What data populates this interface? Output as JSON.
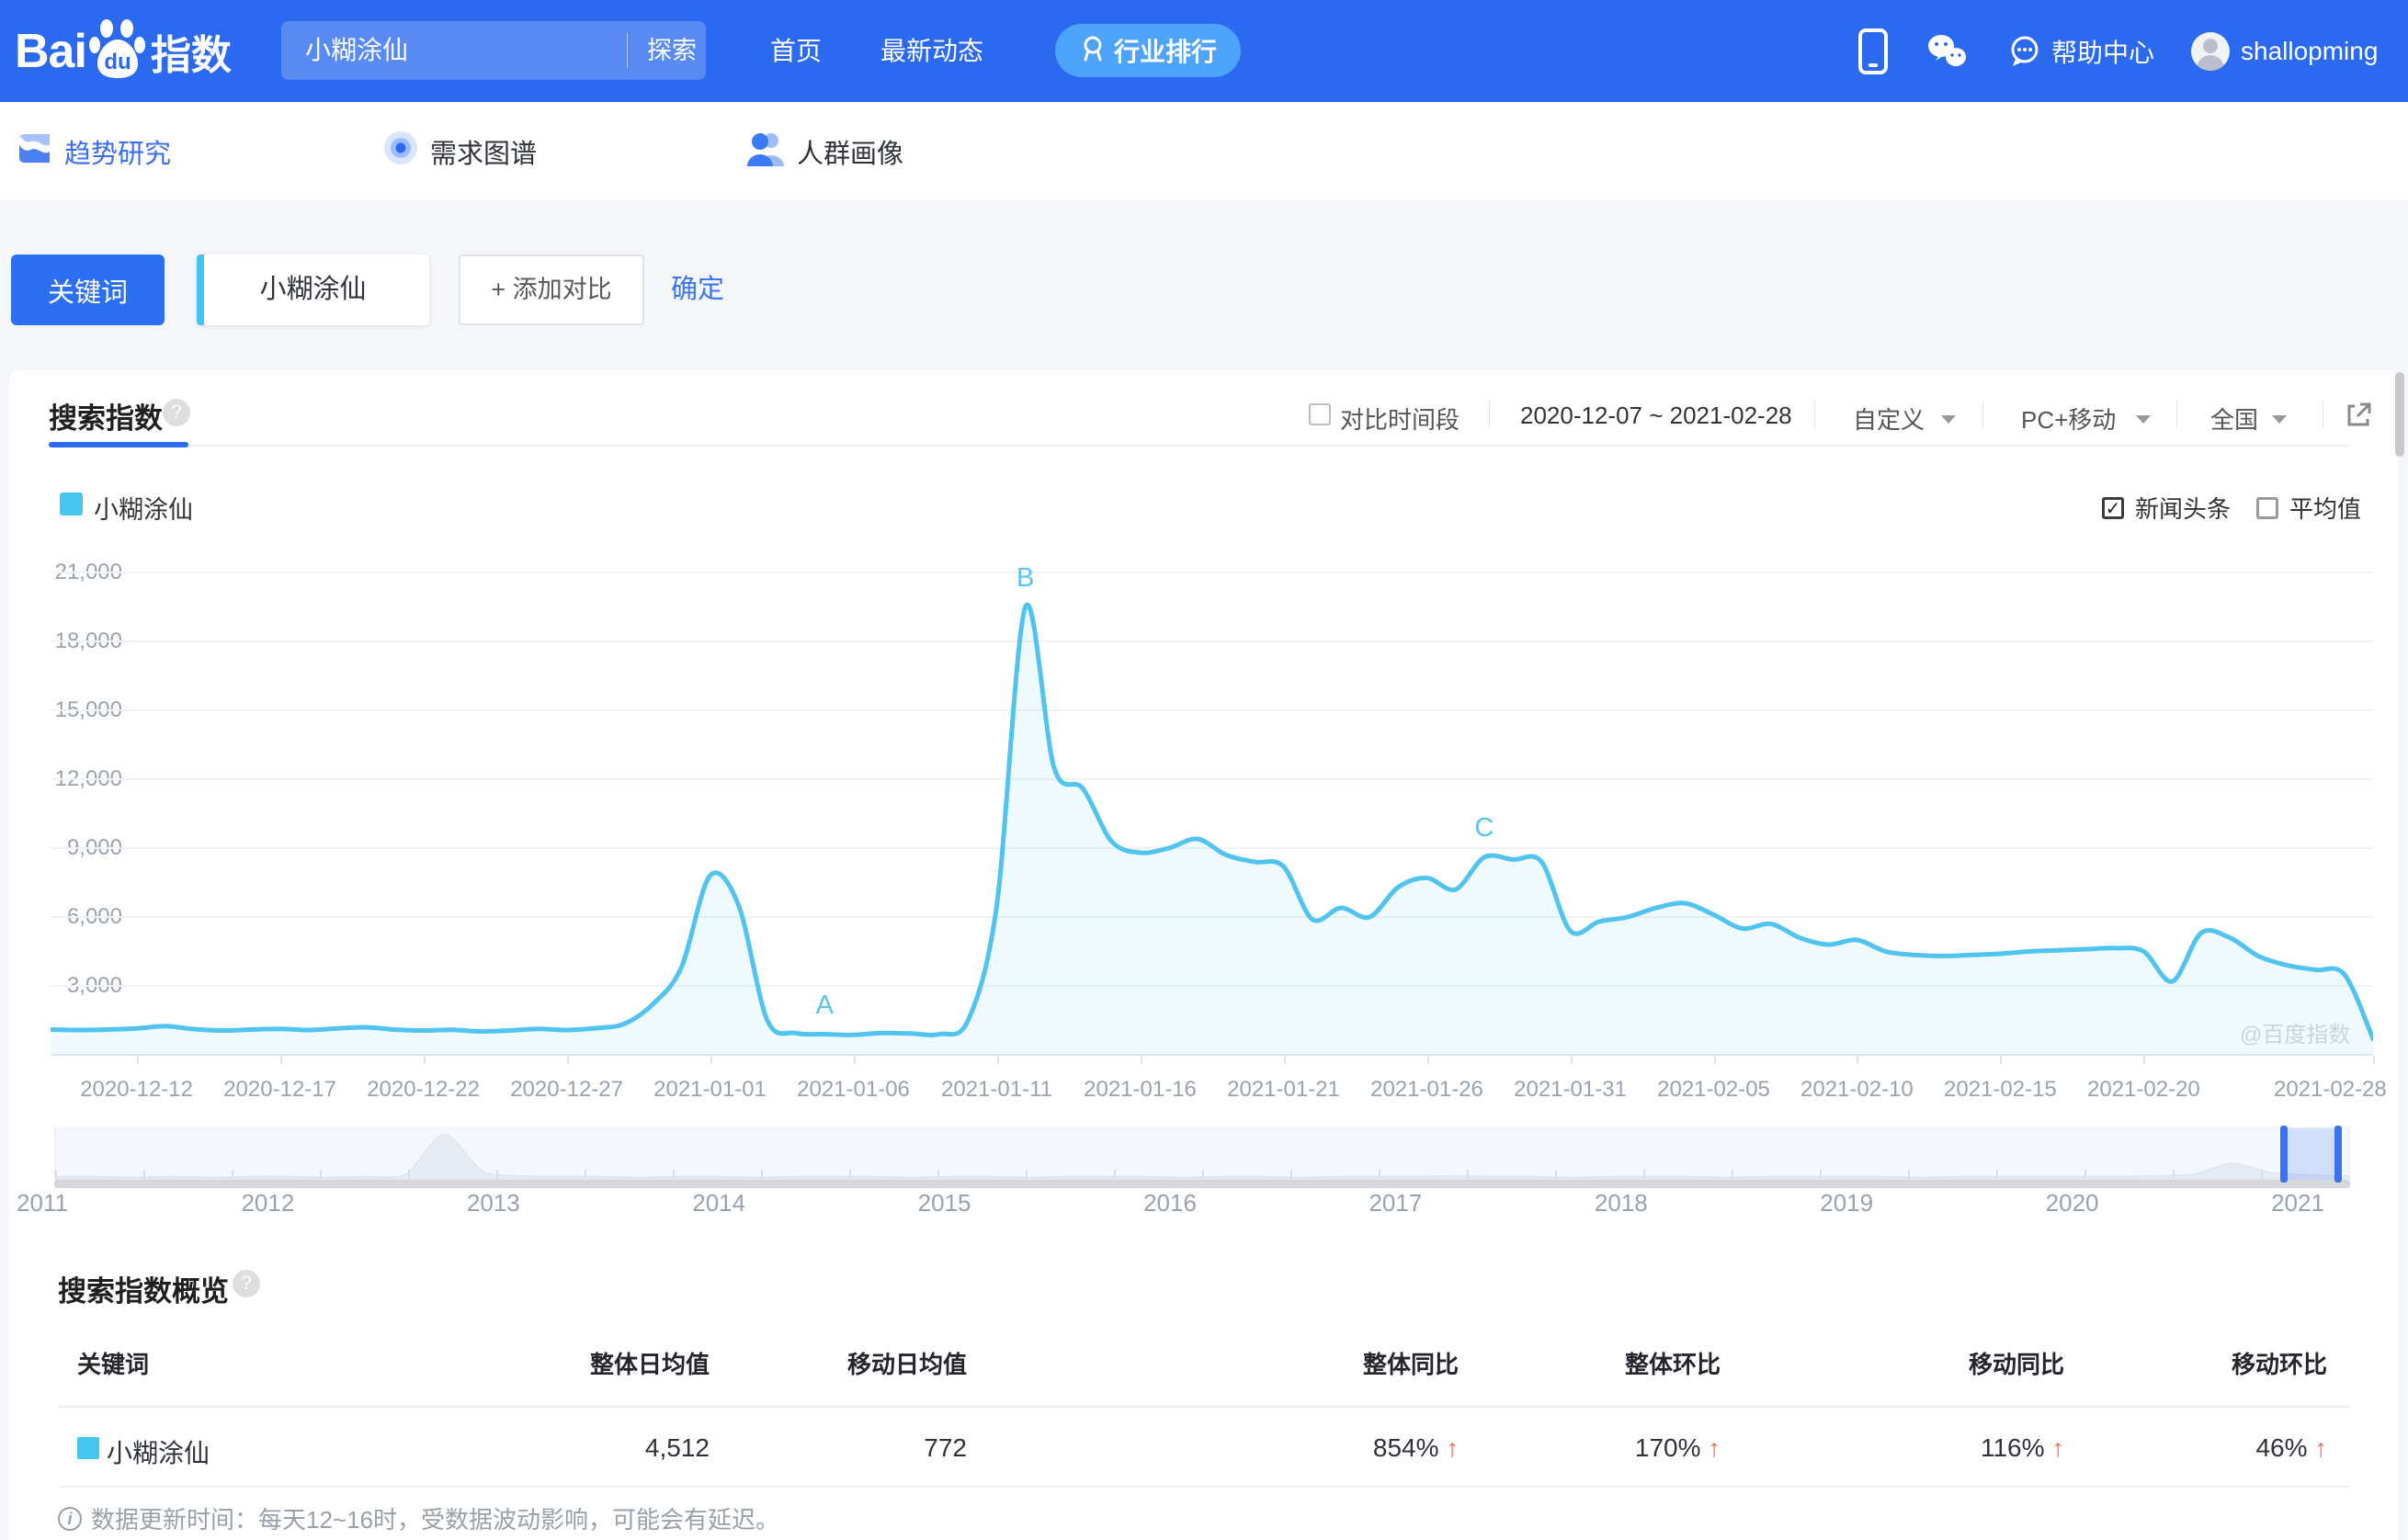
{
  "header": {
    "logo": {
      "bai": "Bai",
      "du": "du",
      "suffix": "指数"
    },
    "search": {
      "value": "小糊涂仙",
      "button": "探索"
    },
    "nav": [
      {
        "label": "首页"
      },
      {
        "label": "最新动态"
      },
      {
        "label": "行业排行"
      }
    ],
    "help_label": "帮助中心",
    "username": "shallopming"
  },
  "subnav": {
    "items": [
      {
        "label": "趋势研究",
        "active": true
      },
      {
        "label": "需求图谱",
        "active": false
      },
      {
        "label": "人群画像",
        "active": false
      }
    ]
  },
  "keyword_bar": {
    "type_button": "关键词",
    "keyword": "小糊涂仙",
    "add_compare": "+ 添加对比",
    "confirm": "确定"
  },
  "chart_card": {
    "title": "搜索指数",
    "compare_period_label": "对比时间段",
    "date_range": "2020-12-07 ~ 2021-02-28",
    "range_mode": "自定义",
    "device": "PC+移动",
    "region": "全国",
    "legend_name": "小糊涂仙",
    "legend_color": "#45c6f1",
    "toggles": [
      {
        "label": "新闻头条",
        "checked": true
      },
      {
        "label": "平均值",
        "checked": false
      }
    ],
    "watermark": "@百度指数"
  },
  "chart_data": {
    "type": "line",
    "title": "搜索指数",
    "ylim": [
      0,
      21000
    ],
    "grid": true,
    "legend_position": "top-left",
    "y_ticks": [
      {
        "label": "21,000",
        "value": 21000
      },
      {
        "label": "18,000",
        "value": 18000
      },
      {
        "label": "15,000",
        "value": 15000
      },
      {
        "label": "12,000",
        "value": 12000
      },
      {
        "label": "9,000",
        "value": 9000
      },
      {
        "label": "6,000",
        "value": 6000
      },
      {
        "label": "3,000",
        "value": 3000
      }
    ],
    "series": [
      {
        "name": "小糊涂仙",
        "color": "#50c3ef",
        "start_date": "2020-12-09",
        "interval_days": 1,
        "values": [
          1100,
          1080,
          1100,
          1150,
          1250,
          1120,
          1060,
          1100,
          1130,
          1080,
          1150,
          1200,
          1100,
          1060,
          1090,
          1020,
          1060,
          1130,
          1080,
          1160,
          1350,
          2200,
          3800,
          7800,
          6500,
          1500,
          950,
          900,
          870,
          950,
          930,
          900,
          1500,
          6500,
          19500,
          12500,
          11600,
          9300,
          8800,
          9000,
          9400,
          8700,
          8400,
          8200,
          5900,
          6400,
          6000,
          7300,
          7700,
          7200,
          8600,
          8500,
          8400,
          5400,
          5800,
          6000,
          6400,
          6600,
          6100,
          5500,
          5700,
          5100,
          4800,
          5000,
          4500,
          4350,
          4300,
          4350,
          4400,
          4500,
          4550,
          4600,
          4650,
          4500,
          3200,
          5300,
          5100,
          4300,
          3900,
          3700,
          3500,
          700
        ]
      }
    ],
    "x_ticks": [
      {
        "label": "2020-12-12",
        "index": 3
      },
      {
        "label": "2020-12-17",
        "index": 8
      },
      {
        "label": "2020-12-22",
        "index": 13
      },
      {
        "label": "2020-12-27",
        "index": 18
      },
      {
        "label": "2021-01-01",
        "index": 23
      },
      {
        "label": "2021-01-06",
        "index": 28
      },
      {
        "label": "2021-01-11",
        "index": 33
      },
      {
        "label": "2021-01-16",
        "index": 38
      },
      {
        "label": "2021-01-21",
        "index": 43
      },
      {
        "label": "2021-01-26",
        "index": 48
      },
      {
        "label": "2021-01-31",
        "index": 53
      },
      {
        "label": "2021-02-05",
        "index": 58
      },
      {
        "label": "2021-02-10",
        "index": 63
      },
      {
        "label": "2021-02-15",
        "index": 68
      },
      {
        "label": "2021-02-20",
        "index": 73
      },
      {
        "label": "2021-02-28",
        "index": 81
      }
    ],
    "annotations": [
      {
        "label": "A",
        "index": 27
      },
      {
        "label": "B",
        "index": 34
      },
      {
        "label": "C",
        "index": 50
      }
    ]
  },
  "timeline": {
    "years": [
      "2011",
      "2012",
      "2013",
      "2014",
      "2015",
      "2016",
      "2017",
      "2018",
      "2019",
      "2020",
      "2021"
    ],
    "mini_values": [
      3,
      3,
      2,
      3,
      2,
      3,
      3,
      2,
      3,
      5,
      58,
      10,
      4,
      3,
      3,
      2,
      3,
      3,
      2,
      3,
      3,
      3,
      2,
      3,
      3,
      2,
      3,
      3,
      3,
      2,
      3,
      3,
      2,
      3,
      3,
      3,
      4,
      3,
      3,
      2,
      3,
      3,
      3,
      2,
      3,
      3,
      3,
      3,
      2,
      3,
      3,
      3,
      3,
      3,
      4,
      6,
      20,
      8,
      5,
      4
    ]
  },
  "overview": {
    "title": "搜索指数概览",
    "columns": [
      "关键词",
      "整体日均值",
      "移动日均值",
      "整体同比",
      "整体环比",
      "移动同比",
      "移动环比"
    ],
    "rows": [
      {
        "keyword": "小糊涂仙",
        "color": "#45c6f1",
        "cells": [
          "4,512",
          "772",
          "854%",
          "170%",
          "116%",
          "46%"
        ],
        "trends": [
          null,
          null,
          "up",
          "up",
          "up",
          "up"
        ]
      }
    ]
  },
  "footer": {
    "note": "数据更新时间：每天12~16时，受数据波动影响，可能会有延迟。"
  }
}
